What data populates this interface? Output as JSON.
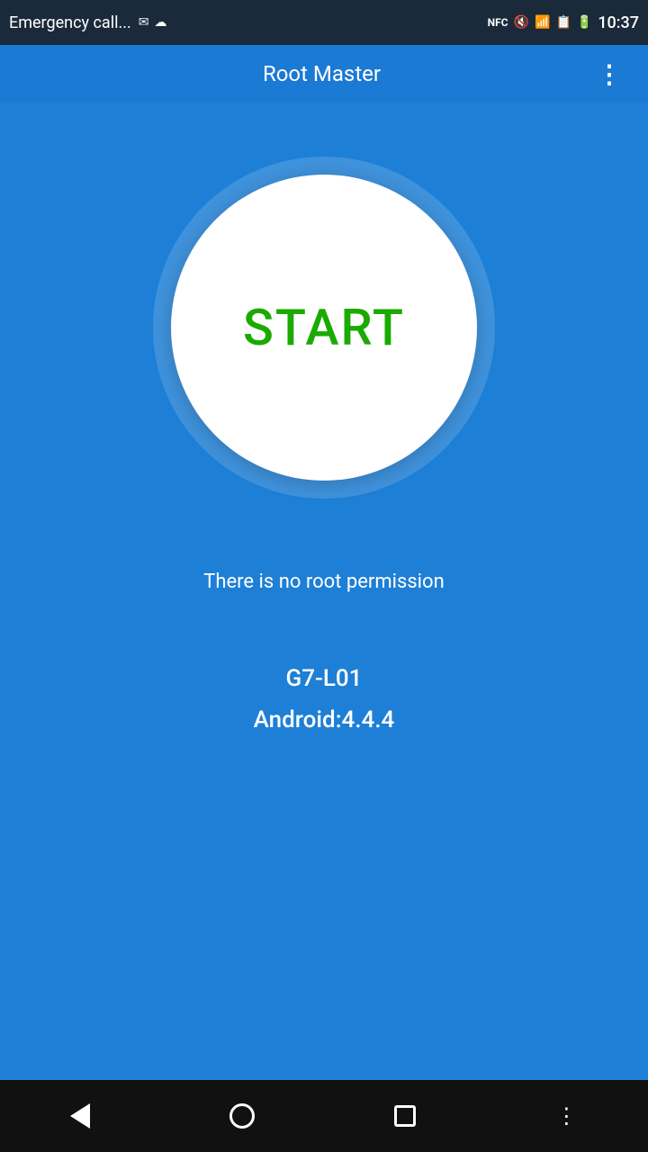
{
  "status_bar": {
    "emergency_text": "Emergency call...",
    "time": "10:37"
  },
  "app_bar": {
    "title": "Root Master",
    "overflow_icon": "⋮"
  },
  "main": {
    "start_button_label": "START",
    "status_message": "There is no root permission",
    "device_model": "G7-L01",
    "android_version": "Android:4.4.4"
  },
  "nav_bar": {
    "back_label": "back",
    "home_label": "home",
    "recents_label": "recents",
    "overflow_label": "overflow"
  },
  "colors": {
    "background": "#1e7fd6",
    "status_bar_bg": "#1a2a3a",
    "nav_bar_bg": "#111111",
    "start_text": "#1aaa00",
    "white": "#ffffff"
  }
}
